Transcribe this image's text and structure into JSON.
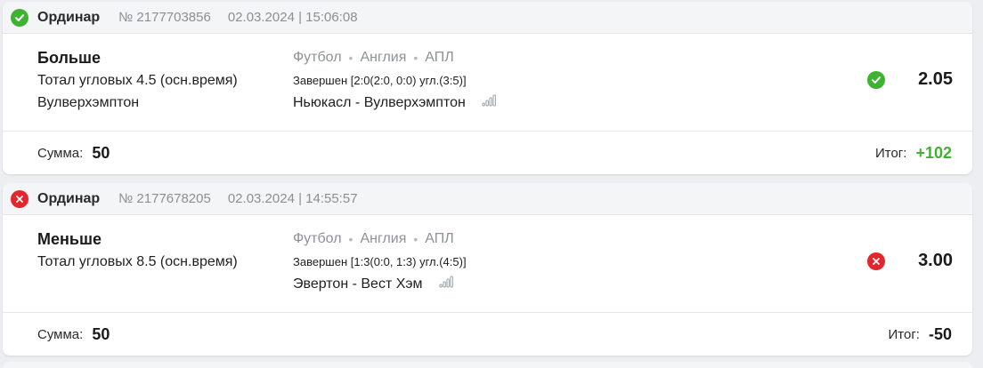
{
  "bets": [
    {
      "status": "won",
      "type": "Ординар",
      "number": "№ 2177703856",
      "datetime": "02.03.2024 | 15:06:08",
      "outcome": {
        "title": "Больше",
        "market": "Тотал угловых 4.5 (осн.время)",
        "team": "Вулверхэмптон"
      },
      "event": {
        "sport": "Футбол",
        "country": "Англия",
        "league": "АПЛ",
        "result": "Завершен [2:0(2:0, 0:0) угл.(3:5)]",
        "teams": "Ньюкасл - Вулверхэмптон"
      },
      "odds": "2.05",
      "sum_label": "Сумма:",
      "sum_value": "50",
      "total_label": "Итог:",
      "total_value": "+102"
    },
    {
      "status": "lost",
      "type": "Ординар",
      "number": "№ 2177678205",
      "datetime": "02.03.2024 | 14:55:57",
      "outcome": {
        "title": "Меньше",
        "market": "Тотал угловых 8.5 (осн.время)",
        "team": ""
      },
      "event": {
        "sport": "Футбол",
        "country": "Англия",
        "league": "АПЛ",
        "result": "Завершен [1:3(0:0, 1:3) угл.(4:5)]",
        "teams": "Эвертон - Вест Хэм"
      },
      "odds": "3.00",
      "sum_label": "Сумма:",
      "sum_value": "50",
      "total_label": "Итог:",
      "total_value": "-50"
    }
  ],
  "colors": {
    "win": "#3fb232",
    "lose": "#e2262c",
    "muted": "#8a8f96",
    "header_bg": "#f4f5f7"
  },
  "icons": {
    "win": "check-circle-icon",
    "lose": "cross-circle-icon",
    "stats": "signal-bars-icon"
  }
}
